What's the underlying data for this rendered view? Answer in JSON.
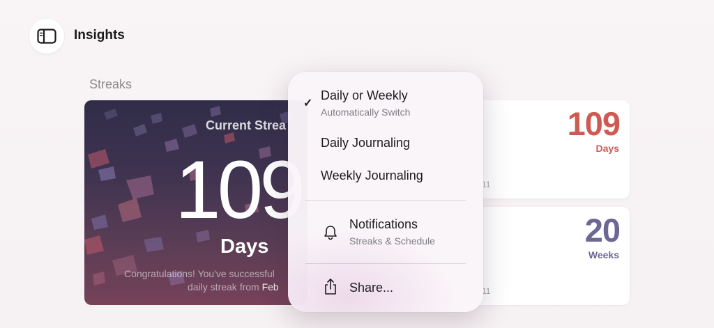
{
  "header": {
    "title": "Insights",
    "sidebar_icon": "sidebar-icon"
  },
  "section": {
    "title": "Streaks"
  },
  "hero": {
    "label": "Current Strea",
    "number": "109",
    "unit": "Days",
    "message_line1": "Congratulations! You've successful",
    "message_line2_prefix": "daily streak from ",
    "message_line2_highlight": "Feb"
  },
  "cards": [
    {
      "number": "109",
      "unit": "Days",
      "date_fragment": "11",
      "color": "#cf5a54"
    },
    {
      "number": "20",
      "unit": "Weeks",
      "date_fragment": "11",
      "color": "#6d6796"
    }
  ],
  "menu": {
    "items": [
      {
        "label": "Daily or Weekly",
        "subtitle": "Automatically Switch",
        "checked": true
      },
      {
        "label": "Daily Journaling"
      },
      {
        "label": "Weekly Journaling"
      },
      {
        "label": "Notifications",
        "subtitle": "Streaks & Schedule",
        "icon": "bell-icon"
      },
      {
        "label": "Share...",
        "icon": "share-icon"
      }
    ]
  }
}
